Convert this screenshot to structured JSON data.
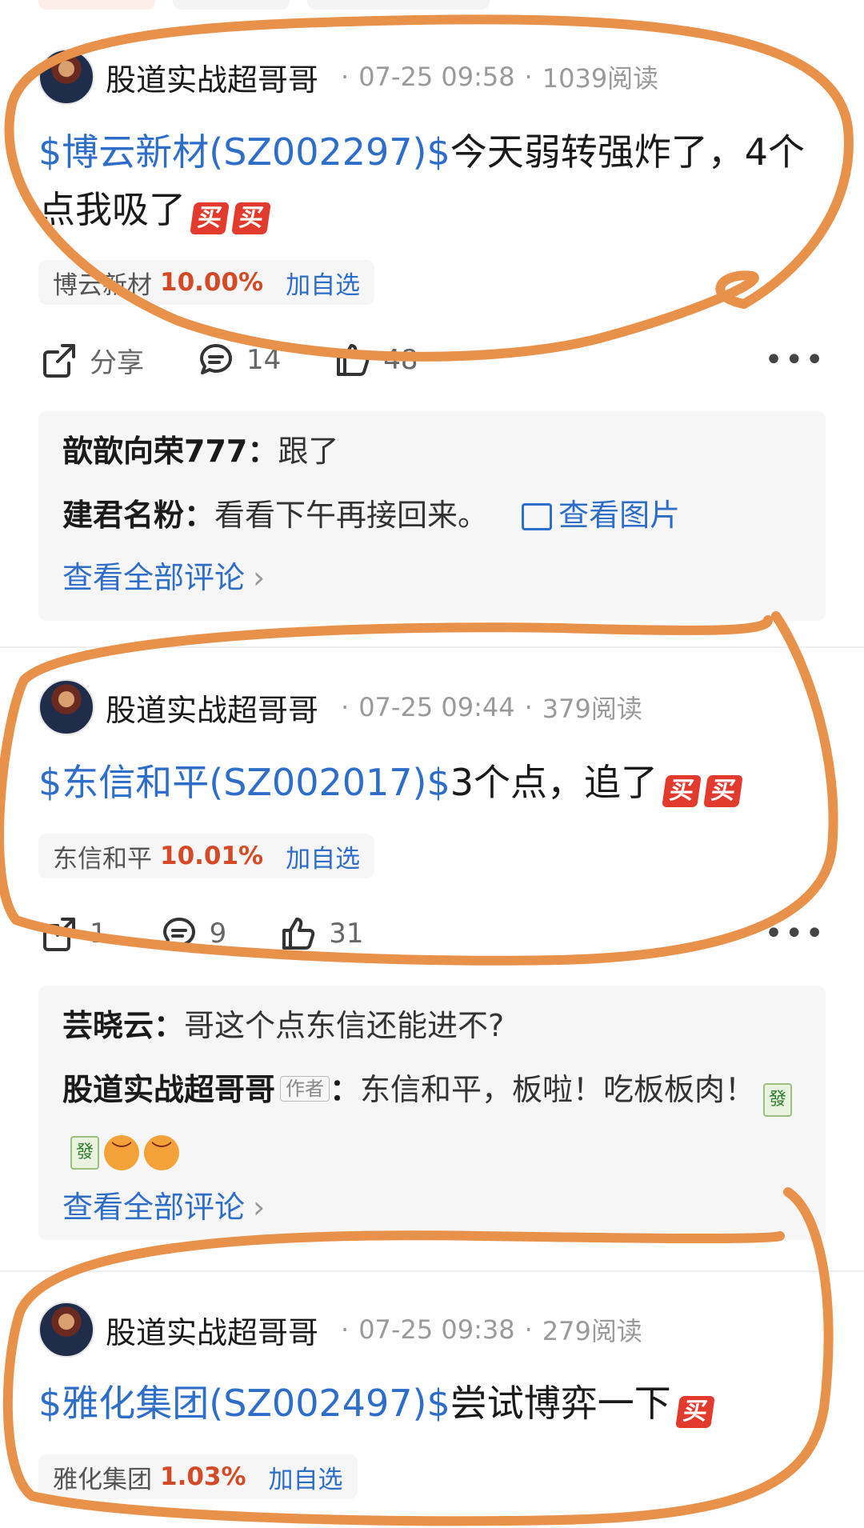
{
  "posts": [
    {
      "author": "股道实战超哥哥",
      "time": "07-25 09:58",
      "reads": "1039阅读",
      "stock_link": "$博云新材(SZ002297)$",
      "text": "今天弱转强炸了，4个点我吸了",
      "emoji": [
        "买",
        "买"
      ],
      "quote": {
        "name": "博云新材",
        "pct": "10.00%",
        "add": "加自选"
      },
      "actions": {
        "share": "分享",
        "comments": "14",
        "likes": "48"
      },
      "comments": [
        {
          "name": "歆歆向荣777",
          "sep": "：",
          "text": "跟了"
        },
        {
          "name": "建君名粉",
          "sep": "：",
          "text": "看看下午再接回来。",
          "image_link": "查看图片"
        }
      ],
      "all_comments": "查看全部评论"
    },
    {
      "author": "股道实战超哥哥",
      "time": "07-25 09:44",
      "reads": "379阅读",
      "stock_link": "$东信和平(SZ002017)$",
      "text": "3个点，追了",
      "emoji": [
        "买",
        "买"
      ],
      "quote": {
        "name": "东信和平",
        "pct": "10.01%",
        "add": "加自选"
      },
      "actions": {
        "share": "1",
        "comments": "9",
        "likes": "31"
      },
      "comments": [
        {
          "name": "芸晓云",
          "sep": "：",
          "text": "哥这个点东信还能进不?"
        },
        {
          "name": "股道实战超哥哥",
          "tag": "作者",
          "sep": "：",
          "text": "东信和平，板啦！吃板板肉！",
          "emoji_tiles": [
            "發",
            "發"
          ]
        }
      ],
      "all_comments": "查看全部评论"
    },
    {
      "author": "股道实战超哥哥",
      "time": "07-25 09:38",
      "reads": "279阅读",
      "stock_link": "$雅化集团(SZ002497)$",
      "text": "尝试博弈一下",
      "emoji": [
        "买"
      ],
      "quote": {
        "name": "雅化集团",
        "pct": "1.03%",
        "add": "加自选"
      }
    }
  ],
  "colors": {
    "link": "#2f6ec8",
    "up": "#d44a26",
    "annotation": "#e8914a"
  },
  "icons": [
    "share-icon",
    "comment-icon",
    "like-icon",
    "more-icon",
    "image-icon"
  ]
}
